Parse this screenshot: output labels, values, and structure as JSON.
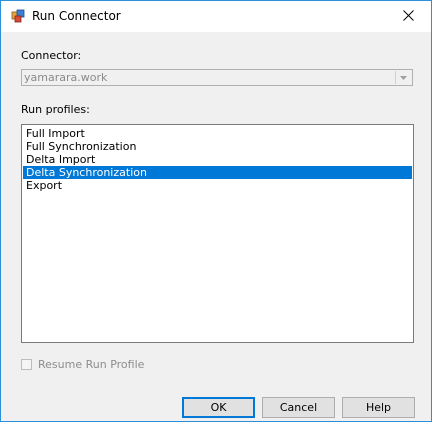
{
  "window": {
    "title": "Run Connector",
    "icon": "connector-app-icon",
    "close_icon": "close-icon"
  },
  "connector": {
    "label": "Connector:",
    "value": "yamarara.work",
    "disabled": true
  },
  "run_profiles": {
    "label": "Run profiles:",
    "items": [
      {
        "label": "Full Import",
        "selected": false
      },
      {
        "label": "Full Synchronization",
        "selected": false
      },
      {
        "label": "Delta Import",
        "selected": false
      },
      {
        "label": "Delta Synchronization",
        "selected": true
      },
      {
        "label": "Export",
        "selected": false
      }
    ]
  },
  "resume": {
    "label": "Resume Run Profile",
    "checked": false,
    "disabled": true
  },
  "buttons": {
    "ok": "OK",
    "cancel": "Cancel",
    "help": "Help"
  },
  "colors": {
    "selection": "#0078d7",
    "window_border": "#2b8fd9"
  }
}
